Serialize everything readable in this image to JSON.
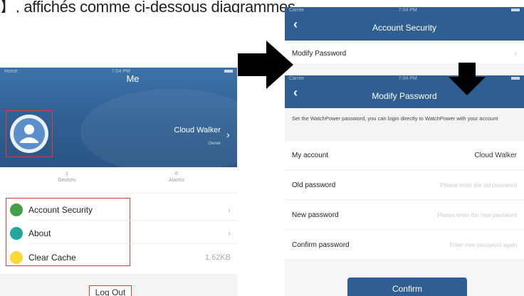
{
  "caption": "】, affichés comme ci-dessous diagrammes.",
  "me_screen": {
    "status": {
      "carrier": "Home",
      "time": "7:04 PM"
    },
    "title": "Me",
    "user": {
      "name": "Cloud Walker",
      "role": "Owner"
    },
    "stats": [
      {
        "value": "1",
        "label": "Devices"
      },
      {
        "value": "0",
        "label": "Alarms"
      }
    ],
    "menu": [
      {
        "label": "Account Security",
        "color": "#43a047",
        "value": ""
      },
      {
        "label": "About",
        "color": "#26a69a",
        "value": ""
      },
      {
        "label": "Clear Cache",
        "color": "#fdd835",
        "value": "1.62KB"
      }
    ],
    "logout": "Log Out"
  },
  "account_security": {
    "status": {
      "carrier": "Carrier",
      "time": "7:04 PM"
    },
    "title": "Account Security",
    "items": [
      "Modify Password"
    ]
  },
  "modify_password": {
    "status": {
      "carrier": "Carrier",
      "time": "7:04 PM"
    },
    "title": "Modify Password",
    "info": "Set the WatchPower password, you can login directly to WatchPower with your account",
    "fields": [
      {
        "label": "My account",
        "value": "Cloud Walker",
        "placeholder": ""
      },
      {
        "label": "Old password",
        "value": "",
        "placeholder": "Please enter the old password"
      },
      {
        "label": "New password",
        "value": "",
        "placeholder": "Please enter the new password"
      },
      {
        "label": "Confirm password",
        "value": "",
        "placeholder": "Enter new password again"
      }
    ],
    "confirm": "Confirm"
  }
}
